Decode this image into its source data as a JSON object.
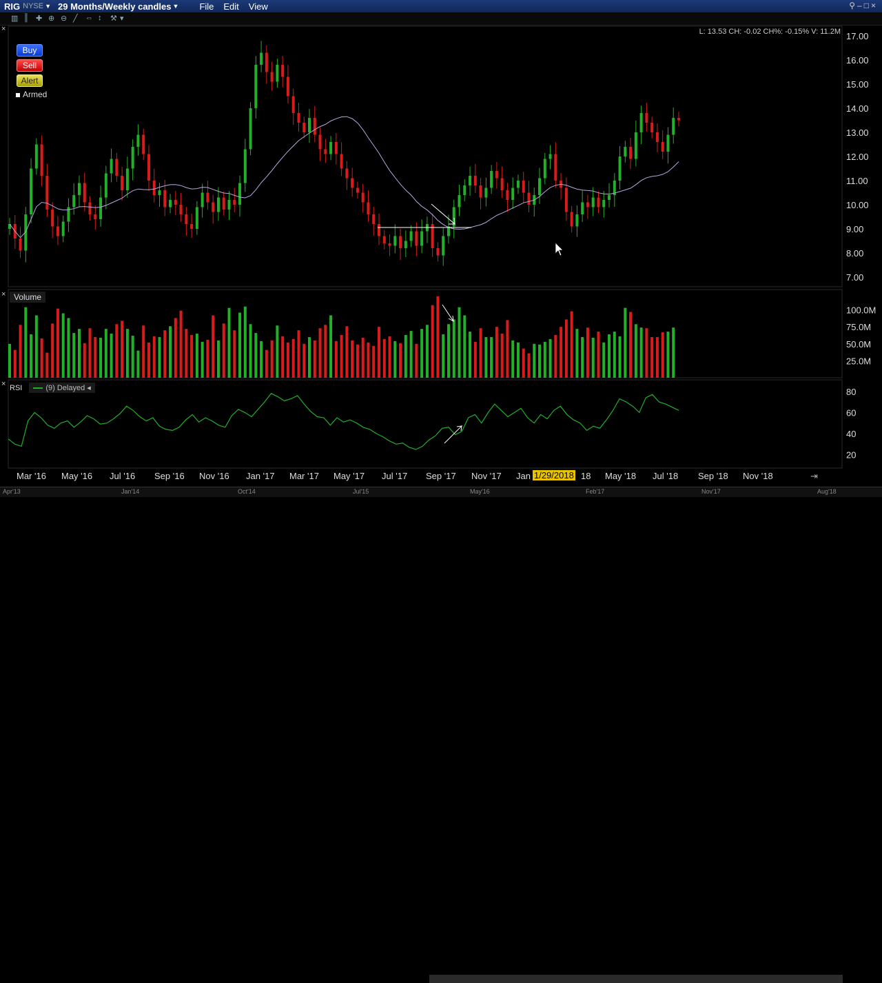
{
  "window": {
    "symbol": "RIG",
    "exchange": "NYSE",
    "period": "29 Months/Weekly candles",
    "menus": [
      "File",
      "Edit",
      "View"
    ]
  },
  "order_buttons": {
    "buy": "Buy",
    "sell": "Sell",
    "alert": "Alert",
    "armed": "Armed"
  },
  "readout": "L: 13.53 CH: -0.02 CH%: -0.15% V: 11.2M",
  "volume_panel": {
    "label": "Volume",
    "ticks": [
      "100.0M",
      "75.0M",
      "50.0M",
      "25.0M"
    ]
  },
  "rsi_panel": {
    "label": "RSI",
    "settings": "(9) Delayed",
    "ticks": [
      "80",
      "60",
      "40",
      "20"
    ]
  },
  "price_ticks": [
    "17.00",
    "16.00",
    "15.00",
    "14.00",
    "13.00",
    "12.00",
    "11.00",
    "10.00",
    "9.00",
    "8.00",
    "7.00"
  ],
  "x_axis": [
    "Mar '16",
    "May '16",
    "Jul '16",
    "Sep '16",
    "Nov '16",
    "Jan '17",
    "Mar '17",
    "May '17",
    "Jul '17",
    "Sep '17",
    "Nov '17",
    "Jan",
    "18",
    "May '18",
    "Jul '18",
    "Sep '18",
    "Nov '18"
  ],
  "selected_date": "1/29/2018",
  "navigator": [
    "Apr'13",
    "Jan'14",
    "Oct'14",
    "Jul'15",
    "May'16",
    "Feb'17",
    "Nov'17",
    "Aug'18"
  ],
  "colors": {
    "up": "#22b02a",
    "down": "#d81c1c",
    "ma": "#b9a7e0",
    "rsi": "#22b02a",
    "highlight": "#e8c400"
  },
  "chart_data": {
    "type": "candlestick",
    "ylim": [
      6.6,
      17.4
    ],
    "closes": [
      9.2,
      8.6,
      8.1,
      9.6,
      11.5,
      12.5,
      11.2,
      9.8,
      9.1,
      8.7,
      9.3,
      9.9,
      10.4,
      10.9,
      10.1,
      9.6,
      9.4,
      10.3,
      11.3,
      11.9,
      11.2,
      10.6,
      11.5,
      12.4,
      12.9,
      12.1,
      11.0,
      10.4,
      10.6,
      9.9,
      10.2,
      10.0,
      9.6,
      9.2,
      9.0,
      9.9,
      10.5,
      10.1,
      9.7,
      10.3,
      9.8,
      10.2,
      10.0,
      10.9,
      12.3,
      14.0,
      15.8,
      16.3,
      15.5,
      15.1,
      15.8,
      15.3,
      14.5,
      13.8,
      13.4,
      13.0,
      13.6,
      12.9,
      12.3,
      12.1,
      12.6,
      12.1,
      11.5,
      11.1,
      10.7,
      10.5,
      10.1,
      9.6,
      9.2,
      8.7,
      8.4,
      8.3,
      8.7,
      8.2,
      8.5,
      8.9,
      8.3,
      8.9,
      9.2,
      8.2,
      7.9,
      8.7,
      9.1,
      9.9,
      10.4,
      10.8,
      11.2,
      10.8,
      10.3,
      10.7,
      11.4,
      11.1,
      10.6,
      10.2,
      10.7,
      11.0,
      10.5,
      10.0,
      10.4,
      11.1,
      11.9,
      12.1,
      11.0,
      10.7,
      9.7,
      9.1,
      9.6,
      10.1,
      9.9,
      10.3,
      9.9,
      10.2,
      10.4,
      11.0,
      12.0,
      12.4,
      11.9,
      13.0,
      13.8,
      13.4,
      13.0,
      12.6,
      12.2,
      12.9,
      13.6,
      13.5
    ],
    "volume_M": [
      50,
      41,
      78,
      104,
      64,
      92,
      58,
      37,
      80,
      102,
      95,
      88,
      66,
      72,
      51,
      73,
      60,
      59,
      72,
      65,
      79,
      84,
      72,
      62,
      40,
      77,
      52,
      61,
      60,
      70,
      76,
      88,
      99,
      72,
      63,
      65,
      53,
      56,
      92,
      55,
      80,
      103,
      70,
      96,
      105,
      79,
      66,
      54,
      41,
      55,
      77,
      61,
      52,
      57,
      70,
      50,
      60,
      55,
      73,
      78,
      92,
      54,
      63,
      76,
      55,
      49,
      59,
      52,
      47,
      75,
      57,
      61,
      54,
      51,
      63,
      69,
      50,
      72,
      78,
      107,
      120,
      64,
      79,
      86,
      104,
      92,
      68,
      53,
      73,
      60,
      60,
      75,
      65,
      85,
      55,
      52,
      43,
      36,
      50,
      49,
      53,
      57,
      63,
      75,
      86,
      98,
      72,
      60,
      74,
      59,
      68,
      52,
      64,
      68,
      61,
      103,
      97,
      79,
      74,
      73,
      60,
      60,
      67,
      68,
      74
    ],
    "rsi": [
      35,
      30,
      28,
      52,
      60,
      55,
      48,
      45,
      50,
      52,
      46,
      51,
      57,
      54,
      49,
      50,
      54,
      59,
      66,
      62,
      56,
      52,
      55,
      47,
      44,
      43,
      46,
      53,
      58,
      51,
      55,
      52,
      48,
      46,
      57,
      63,
      60,
      56,
      63,
      70,
      78,
      75,
      71,
      73,
      76,
      68,
      61,
      56,
      55,
      48,
      55,
      51,
      53,
      50,
      46,
      44,
      40,
      37,
      33,
      30,
      31,
      27,
      25,
      28,
      34,
      38,
      45,
      46,
      39,
      42,
      55,
      58,
      50,
      60,
      68,
      62,
      56,
      60,
      64,
      55,
      50,
      58,
      54,
      62,
      66,
      58,
      53,
      50,
      43,
      47,
      45,
      53,
      62,
      73,
      70,
      66,
      60,
      74,
      77,
      70,
      68,
      65,
      62
    ]
  }
}
